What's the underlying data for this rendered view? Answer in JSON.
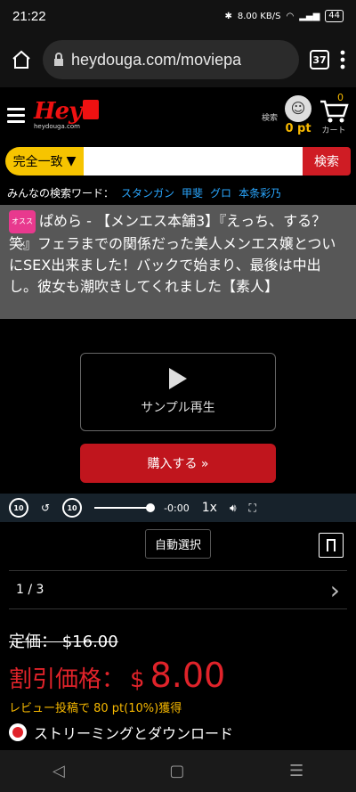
{
  "status": {
    "time": "21:22",
    "speed": "8.00 KB/S",
    "battery": "44"
  },
  "browser": {
    "url": "heydouga.com/moviepa",
    "tab_count": "37"
  },
  "site": {
    "logo": "Hey",
    "logo_sub": "heydouga.com",
    "search_label": "検索",
    "points": "0 pt",
    "cart_label": "カート",
    "cart_count": "0"
  },
  "search": {
    "mode": "完全一致",
    "button": "検索",
    "popular_label": "みんなの検索ワード：",
    "keywords": [
      "スタンガン",
      "甲斐",
      "グロ",
      "本条彩乃"
    ]
  },
  "video": {
    "badge": "オススメ",
    "title": "ぱめら - 【メンエス本舗3】『えっち、する？笑』フェラまでの関係だった美人メンエス嬢とついにSEX出来ました！バックで始まり、最後は中出し。彼女も潮吹きしてくれました【素人】",
    "sample_label": "サンプル再生",
    "buy_label": "購入する »",
    "time": "-0:00",
    "speed": "1x",
    "auto_select": "自動選択"
  },
  "pager": {
    "label": "1 / 3"
  },
  "price": {
    "list_label": "定価： $16.00",
    "sale_label": "割引価格：",
    "sale_currency": "$",
    "sale_amount": "8.00",
    "review_text": "レビュー投稿で 80 pt(10%)獲得",
    "stream_option": "ストリーミングとダウンロード"
  }
}
